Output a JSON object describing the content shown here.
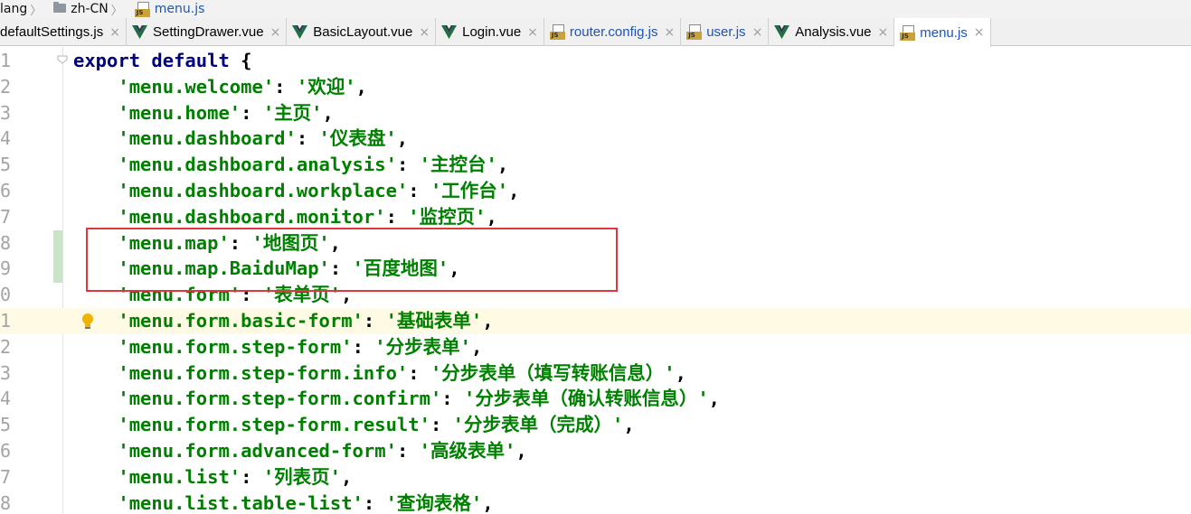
{
  "breadcrumb": [
    "lang",
    "zh-CN",
    "menu.js"
  ],
  "tabs": [
    {
      "label": "defaultSettings.js",
      "icon": "js-file-icon",
      "blue": false,
      "active": false
    },
    {
      "label": "SettingDrawer.vue",
      "icon": "vue-file-icon",
      "blue": false,
      "active": false
    },
    {
      "label": "BasicLayout.vue",
      "icon": "vue-file-icon",
      "blue": false,
      "active": false
    },
    {
      "label": "Login.vue",
      "icon": "vue-file-icon",
      "blue": false,
      "active": false
    },
    {
      "label": "router.config.js",
      "icon": "js-file-icon",
      "blue": true,
      "active": false
    },
    {
      "label": "user.js",
      "icon": "js-file-icon",
      "blue": true,
      "active": false
    },
    {
      "label": "Analysis.vue",
      "icon": "vue-file-icon",
      "blue": false,
      "active": false
    },
    {
      "label": "menu.js",
      "icon": "js-file-icon",
      "blue": true,
      "active": true
    }
  ],
  "tab_close_glyph": "×",
  "js_icon_text": "JS",
  "lines": [
    {
      "n": "1",
      "kw": "export default ",
      "p1": "{",
      "s1": "",
      "p2": "",
      "s2": "",
      "p3": ""
    },
    {
      "n": "2",
      "kw": "",
      "p1": "    ",
      "s1": "'menu.welcome'",
      "p2": ": ",
      "s2": "'欢迎'",
      "p3": ","
    },
    {
      "n": "3",
      "kw": "",
      "p1": "    ",
      "s1": "'menu.home'",
      "p2": ": ",
      "s2": "'主页'",
      "p3": ","
    },
    {
      "n": "4",
      "kw": "",
      "p1": "    ",
      "s1": "'menu.dashboard'",
      "p2": ": ",
      "s2": "'仪表盘'",
      "p3": ","
    },
    {
      "n": "5",
      "kw": "",
      "p1": "    ",
      "s1": "'menu.dashboard.analysis'",
      "p2": ": ",
      "s2": "'主控台'",
      "p3": ","
    },
    {
      "n": "6",
      "kw": "",
      "p1": "    ",
      "s1": "'menu.dashboard.workplace'",
      "p2": ": ",
      "s2": "'工作台'",
      "p3": ","
    },
    {
      "n": "7",
      "kw": "",
      "p1": "    ",
      "s1": "'menu.dashboard.monitor'",
      "p2": ": ",
      "s2": "'监控页'",
      "p3": ","
    },
    {
      "n": "8",
      "kw": "",
      "p1": "    ",
      "s1": "'menu.map'",
      "p2": ": ",
      "s2": "'地图页'",
      "p3": ","
    },
    {
      "n": "9",
      "kw": "",
      "p1": "    ",
      "s1": "'menu.map.BaiduMap'",
      "p2": ": ",
      "s2": "'百度地图'",
      "p3": ","
    },
    {
      "n": "0",
      "kw": "",
      "p1": "    ",
      "s1": "'menu.form'",
      "p2": ": ",
      "s2": "'表单页'",
      "p3": ","
    },
    {
      "n": "1",
      "kw": "",
      "p1": "    ",
      "s1": "'menu.form.basic-form'",
      "p2": ": ",
      "s2": "'基础表单'",
      "p3": ","
    },
    {
      "n": "2",
      "kw": "",
      "p1": "    ",
      "s1": "'menu.form.step-form'",
      "p2": ": ",
      "s2": "'分步表单'",
      "p3": ","
    },
    {
      "n": "3",
      "kw": "",
      "p1": "    ",
      "s1": "'menu.form.step-form.info'",
      "p2": ": ",
      "s2": "'分步表单（填写转账信息）'",
      "p3": ","
    },
    {
      "n": "4",
      "kw": "",
      "p1": "    ",
      "s1": "'menu.form.step-form.confirm'",
      "p2": ": ",
      "s2": "'分步表单（确认转账信息）'",
      "p3": ","
    },
    {
      "n": "5",
      "kw": "",
      "p1": "    ",
      "s1": "'menu.form.step-form.result'",
      "p2": ": ",
      "s2": "'分步表单（完成）'",
      "p3": ","
    },
    {
      "n": "6",
      "kw": "",
      "p1": "    ",
      "s1": "'menu.form.advanced-form'",
      "p2": ": ",
      "s2": "'高级表单'",
      "p3": ","
    },
    {
      "n": "7",
      "kw": "",
      "p1": "    ",
      "s1": "'menu.list'",
      "p2": ": ",
      "s2": "'列表页'",
      "p3": ","
    },
    {
      "n": "8",
      "kw": "",
      "p1": "    ",
      "s1": "'menu.list.table-list'",
      "p2": ": ",
      "s2": "'查询表格'",
      "p3": ","
    }
  ],
  "colors": {
    "keyword": "#000080",
    "string": "#008000",
    "line_number": "#a4a4a4",
    "caret_row": "#fffae3",
    "annotation_box": "#e0363e",
    "vcs_changed": "#c9e4c6"
  }
}
